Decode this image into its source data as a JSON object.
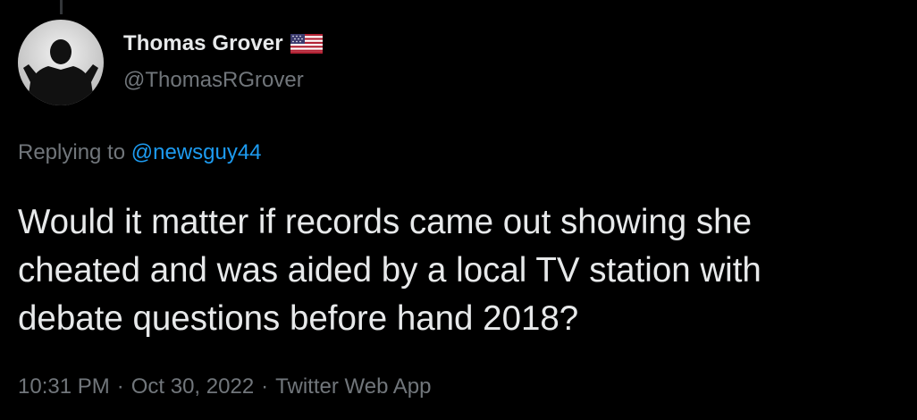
{
  "tweet": {
    "author": {
      "display_name": "Thomas Grover",
      "handle": "@ThomasRGrover",
      "flag_icon": "us-flag-icon",
      "avatar_icon": "avatar-silhouette"
    },
    "reply": {
      "prefix": "Replying to",
      "mention": "@newsguy44"
    },
    "text_lines": [
      "Would it matter if records came out showing she",
      "cheated and was aided by a local TV station with",
      "debate questions before hand 2018?"
    ],
    "meta": {
      "time": "10:31 PM",
      "date": "Oct 30, 2022",
      "source": "Twitter Web App",
      "separator": "·"
    }
  },
  "colors": {
    "background": "#000000",
    "text_primary": "#e7e9ea",
    "text_secondary": "#71767b",
    "link": "#1d9bf0"
  }
}
